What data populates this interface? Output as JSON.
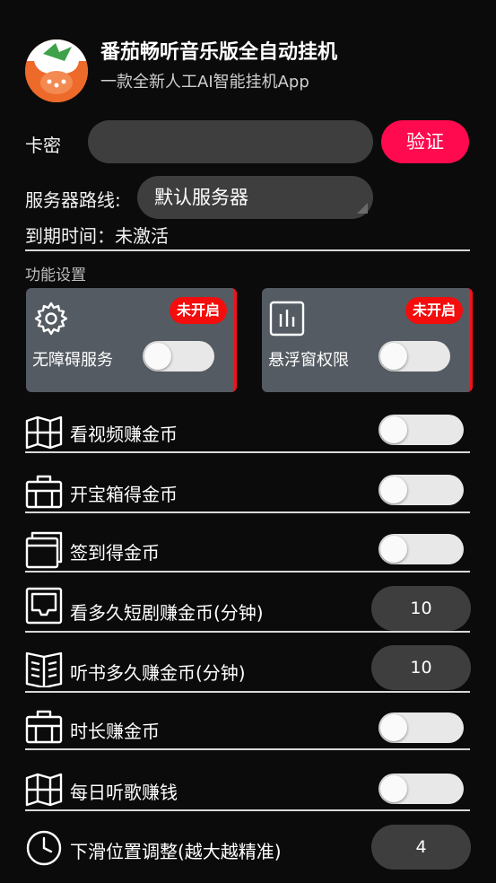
{
  "app": {
    "title": "番茄畅听音乐版全自动挂机",
    "subtitle": "一款全新人工AI智能挂机App"
  },
  "card_key": {
    "label": "卡密",
    "value": "",
    "verify_button": "验证"
  },
  "server": {
    "label": "服务器路线:",
    "selected": "默认服务器"
  },
  "expiry": {
    "text": "到期时间：未激活"
  },
  "section": {
    "title": "功能设置"
  },
  "permission_cards": [
    {
      "label": "无障碍服务",
      "badge": "未开启",
      "icon": "gear-icon",
      "enabled": false
    },
    {
      "label": "悬浮窗权限",
      "badge": "未开启",
      "icon": "bar-chart-icon",
      "enabled": false
    }
  ],
  "settings": [
    {
      "label": "看视频赚金币",
      "type": "toggle",
      "enabled": false,
      "icon": "map-icon"
    },
    {
      "label": "开宝箱得金币",
      "type": "toggle",
      "enabled": false,
      "icon": "briefcase-icon"
    },
    {
      "label": "签到得金币",
      "type": "toggle",
      "enabled": false,
      "icon": "layers-icon"
    },
    {
      "label": "看多久短剧赚金币(分钟)",
      "type": "number",
      "value": "10",
      "icon": "inbox-icon"
    },
    {
      "label": "听书多久赚金币(分钟)",
      "type": "number",
      "value": "10",
      "icon": "book-icon"
    },
    {
      "label": "时长赚金币",
      "type": "toggle",
      "enabled": false,
      "icon": "briefcase-icon"
    },
    {
      "label": "每日听歌赚钱",
      "type": "toggle",
      "enabled": false,
      "icon": "map-icon"
    },
    {
      "label": "下滑位置调整(越大越精准)",
      "type": "number",
      "value": "4",
      "icon": "clock-icon"
    }
  ],
  "colors": {
    "accent": "#ff0a4e",
    "badge": "#f30d0d",
    "card": "#545b62",
    "field": "#3e3e3e",
    "background": "#0b0b0b"
  }
}
